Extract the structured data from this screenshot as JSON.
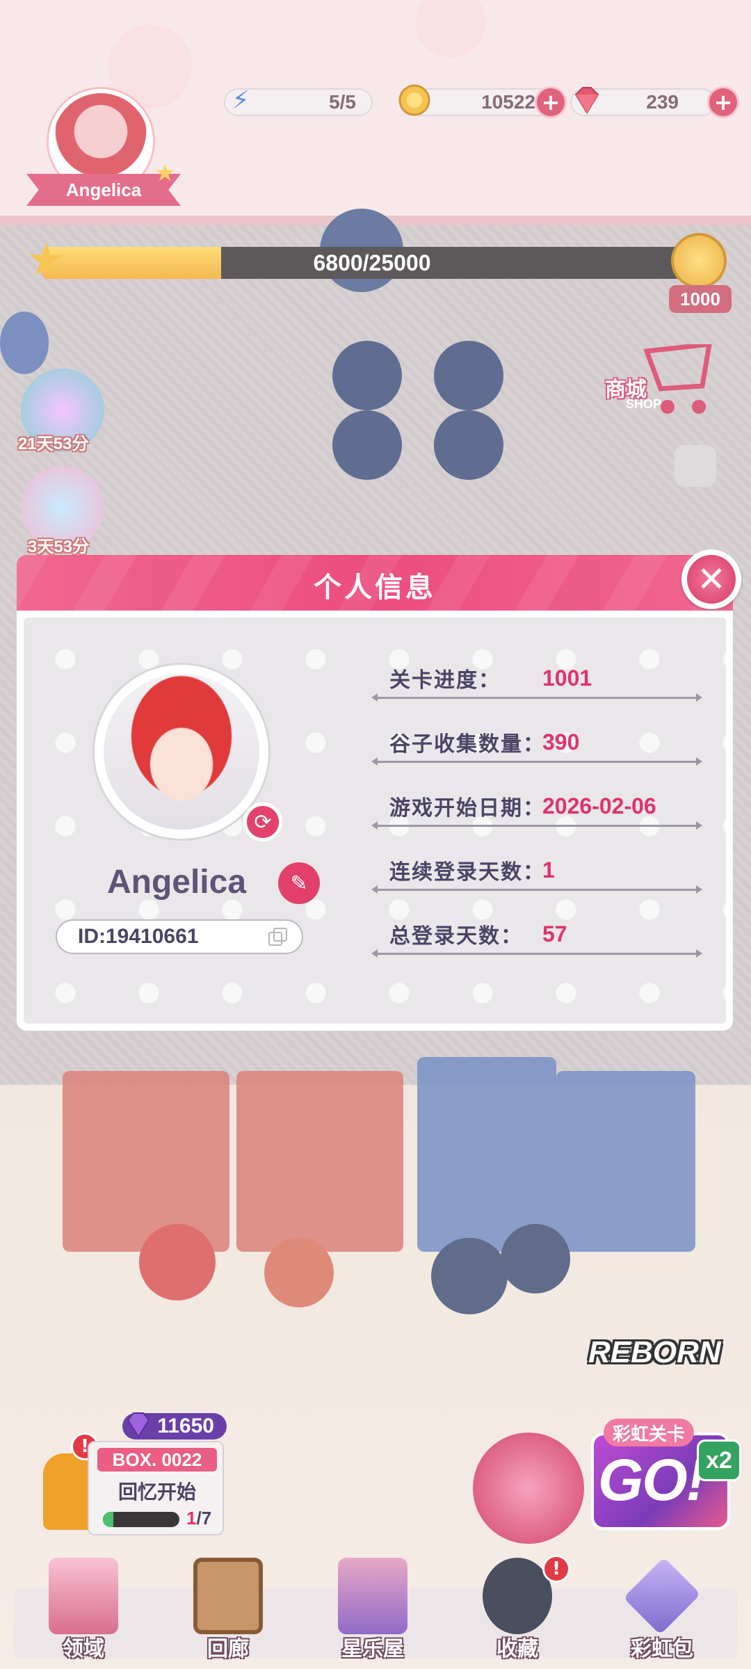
{
  "hud": {
    "player_name": "Angelica",
    "energy": "5/5",
    "coins": "10522",
    "gems": "239",
    "xp_text": "6800/25000",
    "xp_progress": 0.272,
    "level_reward": "1000",
    "plus_symbol": "+"
  },
  "side": {
    "timer_1": "21天53分",
    "timer_2": "3天53分"
  },
  "shop": {
    "label": "商城",
    "sub": "SHOP"
  },
  "modal": {
    "title": "个人信息",
    "close_symbol": "✕",
    "name": "Angelica",
    "id_text": "ID:19410661",
    "stats": [
      {
        "label": "关卡进度：",
        "value": "1001"
      },
      {
        "label": "谷子收集数量：",
        "value": "390"
      },
      {
        "label": "游戏开始日期：",
        "value": "2026-02-06"
      },
      {
        "label": "连续登录天数：",
        "value": "1"
      },
      {
        "label": "总登录天数：",
        "value": "57"
      }
    ]
  },
  "event": {
    "rainbow_label": "彩虹关卡",
    "go_text": "GO!",
    "multiplier": "x2",
    "reborn_text": "REBORN"
  },
  "box": {
    "gems": "11650",
    "title": "BOX. 0022",
    "subtitle": "回忆开始",
    "count_current": "1",
    "count_total": "/7",
    "progress": 0.14
  },
  "nav": {
    "items": [
      {
        "label": "领域"
      },
      {
        "label": "回廊"
      },
      {
        "label": "星乐屋"
      },
      {
        "label": "收藏"
      },
      {
        "label": "彩虹包"
      }
    ]
  },
  "colors": {
    "accent_pink": "#ec4d7f",
    "value_red": "#e0336b",
    "label_dark": "#4b4465"
  }
}
